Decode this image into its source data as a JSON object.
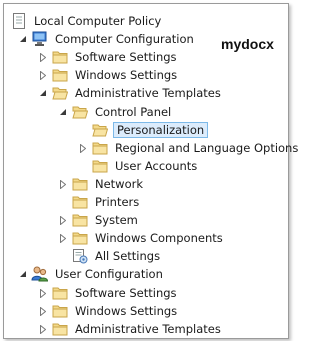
{
  "watermark": "mydocx",
  "tree": {
    "root": "Local Computer Policy",
    "computer_configuration": "Computer Configuration",
    "cc_software_settings": "Software Settings",
    "cc_windows_settings": "Windows Settings",
    "cc_administrative_templates": "Administrative Templates",
    "control_panel": "Control Panel",
    "personalization": "Personalization",
    "regional_language": "Regional and Language Options",
    "user_accounts": "User Accounts",
    "network": "Network",
    "printers": "Printers",
    "system": "System",
    "windows_components": "Windows Components",
    "all_settings": "All Settings",
    "user_configuration": "User Configuration",
    "uc_software_settings": "Software Settings",
    "uc_windows_settings": "Windows Settings",
    "uc_administrative_templates": "Administrative Templates"
  },
  "colors": {
    "folder": "#f3d98a",
    "selection": "#dcecfc",
    "selection_border": "#7db9e8"
  }
}
